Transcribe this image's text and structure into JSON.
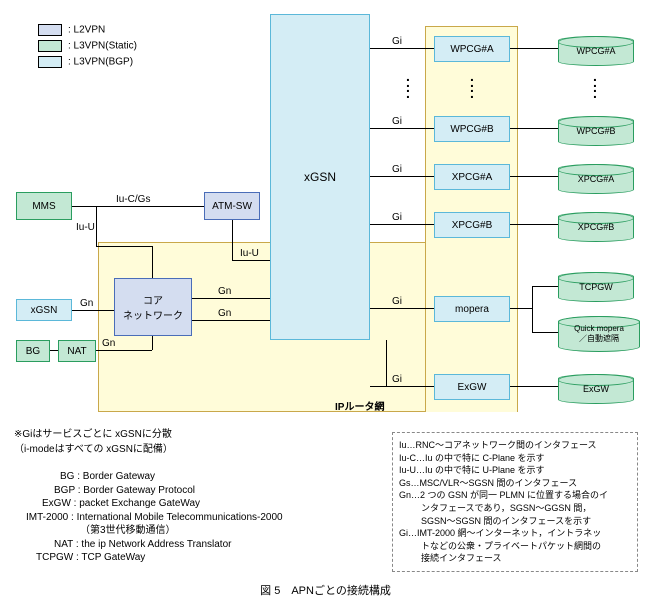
{
  "legend": {
    "l2vpn": ": L2VPN",
    "l3vpn_s": ": L3VPN(Static)",
    "l3vpn_b": ": L3VPN(BGP)"
  },
  "nodes": {
    "mms": "MMS",
    "xgsn_left": "xGSN",
    "bg": "BG",
    "nat": "NAT",
    "atmsw": "ATM-SW",
    "core": "コア\nネットワーク",
    "xgsn_big": "xGSN",
    "wpcga": "WPCG#A",
    "wpcgb": "WPCG#B",
    "xpcga": "XPCG#A",
    "xpcgb": "XPCG#B",
    "mopera": "mopera",
    "exgw": "ExGW"
  },
  "cyls": {
    "wpcga": "WPCG#A",
    "wpcgb": "WPCG#B",
    "xpcga": "XPCG#A",
    "xpcgb": "XPCG#B",
    "tcpgw": "TCPGW",
    "quick": "Quick mopera\n／自動遮隔",
    "exgw": "ExGW"
  },
  "conn": {
    "iucgs": "Iu-C/Gs",
    "iuu1": "Iu-U",
    "iuu2": "Iu-U",
    "gn1": "Gn",
    "gn2": "Gn",
    "gn3": "Gn",
    "gn4": "Gn",
    "gi1": "Gi",
    "gi2": "Gi",
    "gi3": "Gi",
    "gi4": "Gi",
    "gi5": "Gi",
    "gi6": "Gi"
  },
  "iprouter": "IPルータ網",
  "note_gi": "※Giはサービスごとに xGSNに分散\n（i-modeはすべての xGSNに配備）",
  "glossary_left": [
    "BG : Border Gateway",
    "BGP : Border Gateway Protocol",
    "ExGW : packet Exchange GateWay",
    "IMT-2000 : International Mobile Telecommunications-2000",
    "（第3世代移動通信）",
    "NAT : the ip Network Address Translator",
    "TCPGW : TCP GateWay"
  ],
  "glossary_right": [
    "Iu…RNC～コアネットワーク間のインタフェース",
    "Iu-C…Iu の中で特に C-Plane を示す",
    "Iu-U…Iu の中で特に U-Plane を示す",
    "Gs…MSC/VLR～SGSN 間のインタフェース",
    "Gn…2 つの GSN が同一 PLMN に位置する場合のイ",
    "ンタフェースであり，SGSN～GGSN 間，",
    "SGSN～SGSN 間のインタフェースを示す",
    "Gi…IMT-2000 網～インターネット，イントラネッ",
    "トなどの公衆・プライベートパケット網間の",
    "接続インタフェース"
  ],
  "caption": "図 5　APNごとの接続構成"
}
